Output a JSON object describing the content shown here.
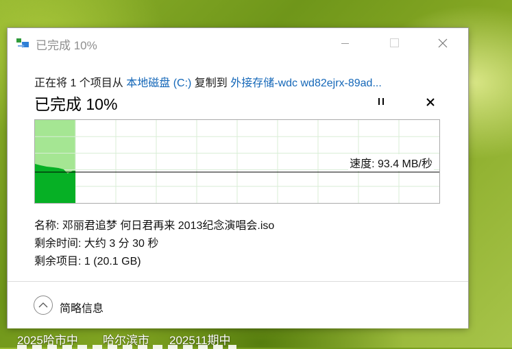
{
  "window": {
    "title": "已完成 10%"
  },
  "copy": {
    "prefix": "正在将 1 个项目从 ",
    "source": "本地磁盘 (C:)",
    "middle": " 复制到 ",
    "destination": "外接存储-wdc wd82ejrx-89ad...",
    "heading": "已完成 10%",
    "progress_percent": 10
  },
  "graph": {
    "speed_label": "速度: 93.4 MB/秒",
    "fill_color": "#06b025",
    "done_color": "#a5e693",
    "grid_color": "#d8eed6"
  },
  "details": {
    "name": "名称: 邓丽君追梦 何日君再来 2013纪念演唱会.iso",
    "time_left": "剩余时间: 大约 3 分 30 秒",
    "items_left": "剩余项目: 1 (20.1 GB)"
  },
  "footer": {
    "toggle_label": "简略信息"
  },
  "desktop": {
    "labels": [
      "2025哈市中",
      "哈尔滨市",
      "202511期中"
    ]
  }
}
